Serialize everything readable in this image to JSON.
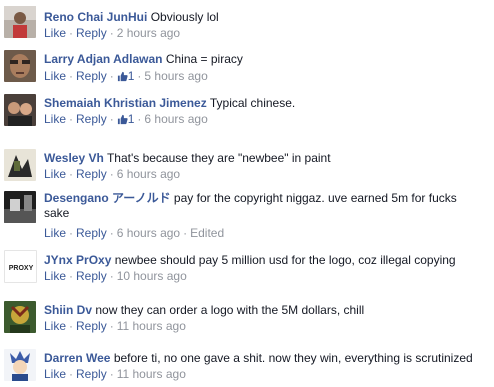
{
  "comments": [
    {
      "author": "Reno Chai JunHui",
      "text": "Obviously lol",
      "like": "Like",
      "reply": "Reply",
      "time": "2 hours ago",
      "avatar": "avatar-photo"
    },
    {
      "author": "Larry Adjan Adlawan",
      "text": "China = piracy",
      "like": "Like",
      "reply": "Reply",
      "likes": "1",
      "time": "5 hours ago",
      "avatar": "avatar-photo"
    },
    {
      "author": "Shemaiah Khristian Jimenez",
      "text": "Typical chinese.",
      "like": "Like",
      "reply": "Reply",
      "likes": "1",
      "time": "6 hours ago",
      "avatar": "avatar-photo"
    },
    {
      "author": "Wesley Vh",
      "text": "That's because they are \"newbee\" in paint",
      "like": "Like",
      "reply": "Reply",
      "time": "6 hours ago",
      "avatar": "avatar-photo"
    },
    {
      "author": "Desengano アーノルド",
      "text": "pay for the copyright niggaz. uve earned 5m for fucks sake",
      "like": "Like",
      "reply": "Reply",
      "time": "6 hours ago",
      "edited": "Edited",
      "avatar": "avatar-photo"
    },
    {
      "author": "JYnx PrOxy",
      "text": "newbee should pay 5 million usd for the logo, coz illegal copying",
      "like": "Like",
      "reply": "Reply",
      "time": "10 hours ago",
      "avatar": "avatar-logo",
      "avatar_text": "PROXY"
    },
    {
      "author": "Shiin Dv",
      "text": "now they can order a logo with the 5M dollars, chill",
      "like": "Like",
      "reply": "Reply",
      "time": "11 hours ago",
      "avatar": "avatar-photo"
    },
    {
      "author": "Darren Wee",
      "text": "before ti, no one gave a shit. now they win, everything is scrutinized",
      "like": "Like",
      "reply": "Reply",
      "time": "11 hours ago",
      "avatar": "avatar-anime"
    }
  ],
  "colors": {
    "link": "#3b5998",
    "meta": "#90949c",
    "text": "#141823"
  }
}
